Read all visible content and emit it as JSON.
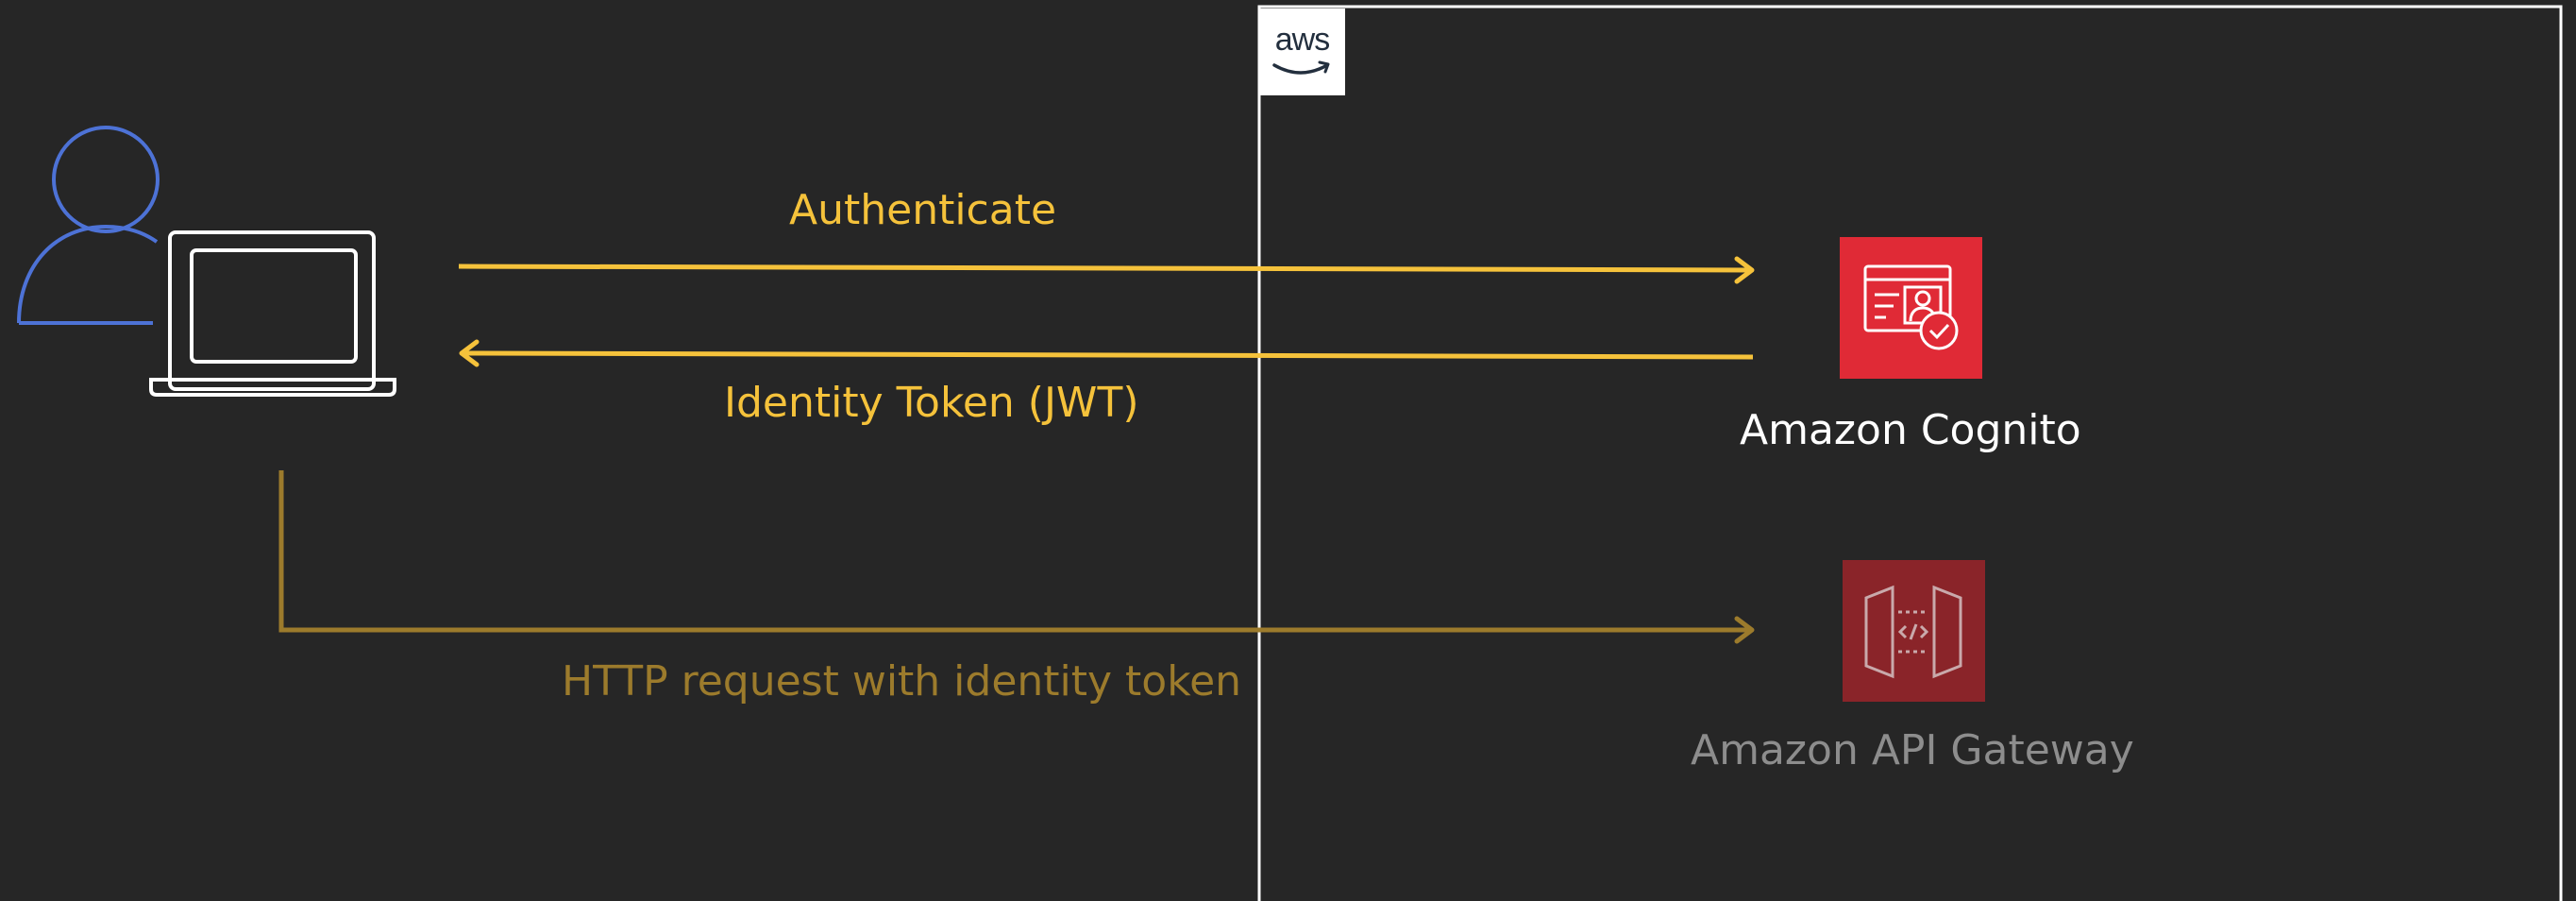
{
  "aws_badge": {
    "text": "aws"
  },
  "arrows": {
    "authenticate": "Authenticate",
    "identity_token": "Identity Token (JWT)",
    "http_request": "HTTP request with identity token"
  },
  "services": {
    "cognito": {
      "label": "Amazon Cognito",
      "icon": "amazon-cognito-icon",
      "color": "#e02a36"
    },
    "api_gateway": {
      "label": "Amazon API Gateway",
      "icon": "amazon-api-gateway-icon",
      "color": "#8a2429"
    }
  },
  "colors": {
    "background": "#262626",
    "user_icon": "#4d72d6",
    "laptop_icon": "#ffffff",
    "flow_bright": "#f5c23b",
    "flow_dim": "#9c7b2c",
    "aws_boundary": "#ffffff"
  }
}
